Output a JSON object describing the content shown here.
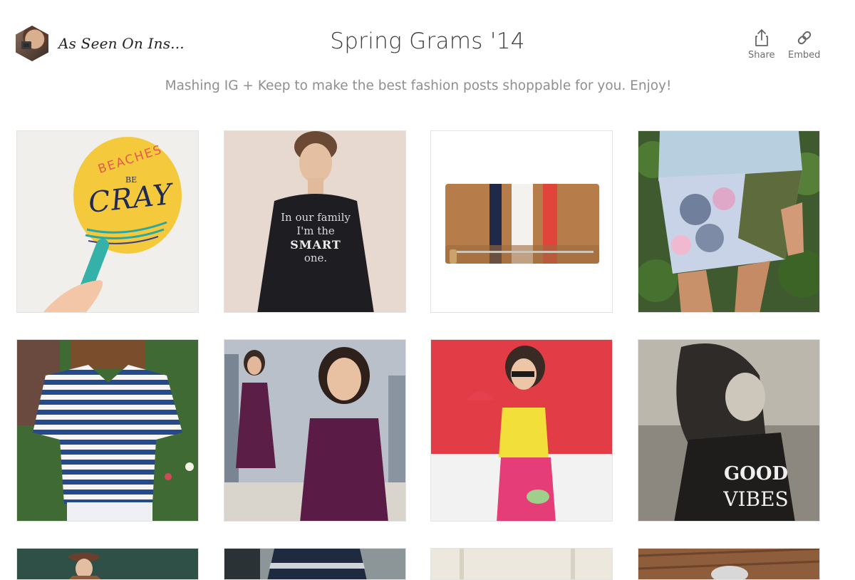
{
  "header": {
    "profile_name": "As Seen On Ins...",
    "title": "Spring Grams '14",
    "subtitle": "Mashing IG + Keep to make the best fashion posts shoppable for you. Enjoy!",
    "actions": {
      "share": "Share",
      "embed": "Embed"
    }
  },
  "tiles": {
    "paddle": {
      "beaches": "BEACHES",
      "be": "BE",
      "cray": "CRAY"
    },
    "sweater": {
      "line1": "In our family",
      "line2": "I'm the",
      "line3": "SMART",
      "line4": "one."
    },
    "vibes": {
      "line1": "GOOD",
      "line2": "VIBES"
    }
  },
  "icons": {
    "share": "share-icon",
    "embed": "link-icon"
  },
  "colors": {
    "title": "#3d3d3d",
    "subtitle": "#8f8f8f",
    "tile_border": "#e3e3e3"
  }
}
